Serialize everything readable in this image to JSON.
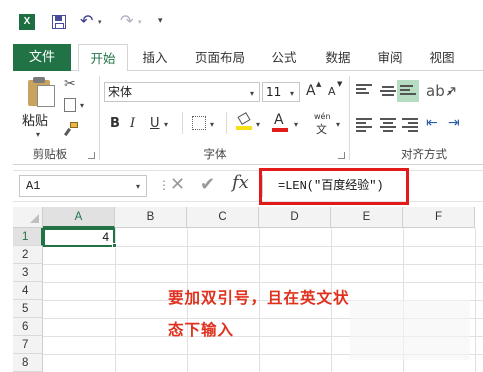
{
  "quick_access": {
    "app_icon": "excel-icon",
    "app_letter": "X",
    "save_icon": "save-icon",
    "undo_glyph": "↶",
    "redo_glyph": "↷",
    "dropdown_glyph": "▾"
  },
  "tabs": {
    "file": "文件",
    "items": [
      "开始",
      "插入",
      "页面布局",
      "公式",
      "数据",
      "审阅",
      "视图"
    ]
  },
  "ribbon": {
    "clipboard": {
      "paste_label": "粘贴",
      "group_label": "剪贴板"
    },
    "font": {
      "font_name": "宋体",
      "font_size": "11",
      "grow_label": "A",
      "shrink_label": "A",
      "bold": "B",
      "italic": "I",
      "underline": "U",
      "fill_label": "A",
      "font_color_label": "A",
      "phonetic_top": "wén",
      "phonetic_bottom": "文",
      "group_label": "字体",
      "fill_color": "#f7e11b",
      "font_color": "#e21a1a"
    },
    "alignment": {
      "group_label": "对齐方式"
    }
  },
  "formula_bar": {
    "name_box": "A1",
    "cancel_glyph": "✕",
    "enter_glyph": "✔",
    "fx_label": "fx",
    "formula": "=LEN(″百度经验″)"
  },
  "grid": {
    "columns": [
      "A",
      "B",
      "C",
      "D",
      "E",
      "F"
    ],
    "rows": [
      "1",
      "2",
      "3",
      "4",
      "5",
      "6",
      "7",
      "8"
    ],
    "cell_a1": "4"
  },
  "annotation": {
    "line1": "要加双引号，且在英文状",
    "line2": "态下输入",
    "color": "#e0301e"
  },
  "colors": {
    "accent": "#217346",
    "highlight_frame": "#e21a1a"
  }
}
